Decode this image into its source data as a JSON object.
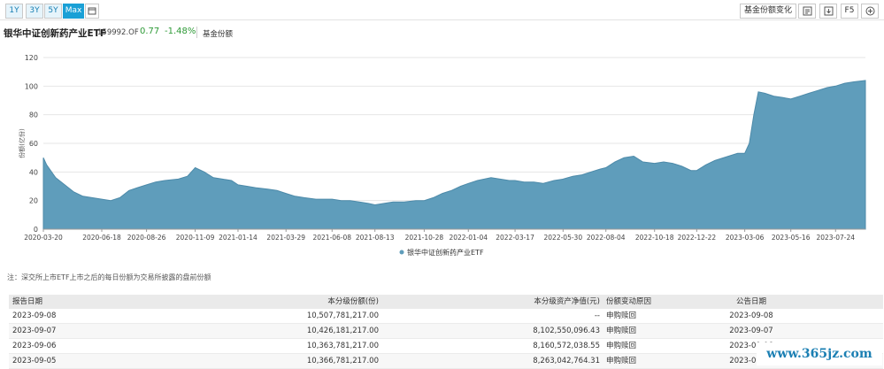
{
  "toolbar": {
    "ranges": [
      "1Y",
      "3Y",
      "5Y",
      "Max"
    ],
    "active_range": "Max",
    "calendar_icon": "calendar-icon",
    "change_label": "基金份额变化",
    "export_icon": "export-icon",
    "download_icon": "download-icon",
    "f5_label": "F5",
    "add_icon": "plus-circle-icon"
  },
  "fund": {
    "name": "银华中证创新药产业ETF",
    "code": "159992.OF",
    "price": "0.77",
    "change": "-1.48%",
    "metric": "基金份额"
  },
  "colors": {
    "area_fill": "#5f9dbb",
    "area_stroke": "#4d8aa9",
    "active": "#1aa0d6",
    "positive_change": "#2e9a37"
  },
  "chart_data": {
    "type": "area",
    "ylabel": "份额(亿份)",
    "ylim": [
      0,
      120
    ],
    "yticks": [
      "0",
      "20",
      "40",
      "60",
      "80",
      "100",
      "120"
    ],
    "xticks": [
      "2020-03-20",
      "2020-06-18",
      "2020-08-26",
      "2020-11-09",
      "2021-01-14",
      "2021-03-29",
      "2021-06-08",
      "2021-08-13",
      "2021-10-28",
      "2022-01-04",
      "2022-03-17",
      "2022-05-30",
      "2022-08-04",
      "2022-10-18",
      "2022-12-22",
      "2023-03-06",
      "2023-05-16",
      "2023-07-24"
    ],
    "x": [
      "2020-03-20",
      "2020-03-25",
      "2020-04-08",
      "2020-04-22",
      "2020-05-06",
      "2020-05-20",
      "2020-06-03",
      "2020-06-18",
      "2020-07-02",
      "2020-07-16",
      "2020-07-30",
      "2020-08-12",
      "2020-08-26",
      "2020-09-09",
      "2020-09-23",
      "2020-10-14",
      "2020-10-28",
      "2020-11-09",
      "2020-11-23",
      "2020-12-07",
      "2020-12-21",
      "2021-01-04",
      "2021-01-14",
      "2021-01-28",
      "2021-02-10",
      "2021-03-01",
      "2021-03-15",
      "2021-03-29",
      "2021-04-12",
      "2021-04-26",
      "2021-05-14",
      "2021-05-28",
      "2021-06-08",
      "2021-06-22",
      "2021-07-06",
      "2021-07-20",
      "2021-08-03",
      "2021-08-13",
      "2021-08-27",
      "2021-09-10",
      "2021-09-27",
      "2021-10-15",
      "2021-10-28",
      "2021-11-11",
      "2021-11-25",
      "2021-12-09",
      "2021-12-23",
      "2022-01-04",
      "2022-01-18",
      "2022-02-08",
      "2022-02-22",
      "2022-03-08",
      "2022-03-17",
      "2022-03-31",
      "2022-04-15",
      "2022-04-29",
      "2022-05-16",
      "2022-05-30",
      "2022-06-14",
      "2022-06-28",
      "2022-07-12",
      "2022-07-26",
      "2022-08-04",
      "2022-08-18",
      "2022-09-01",
      "2022-09-16",
      "2022-09-30",
      "2022-10-18",
      "2022-11-01",
      "2022-11-15",
      "2022-11-29",
      "2022-12-13",
      "2022-12-22",
      "2023-01-05",
      "2023-01-19",
      "2023-02-09",
      "2023-02-23",
      "2023-03-06",
      "2023-03-13",
      "2023-03-20",
      "2023-03-27",
      "2023-04-06",
      "2023-04-20",
      "2023-05-04",
      "2023-05-16",
      "2023-05-30",
      "2023-06-13",
      "2023-06-27",
      "2023-07-11",
      "2023-07-24",
      "2023-08-07",
      "2023-08-21",
      "2023-09-08"
    ],
    "series": [
      {
        "name": "银华中证创新药产业ETF",
        "values": [
          50,
          45,
          36,
          31,
          26,
          23,
          22,
          21,
          20,
          22,
          27,
          29,
          31,
          33,
          34,
          35,
          37,
          43,
          40,
          36,
          35,
          34,
          31,
          30,
          29,
          28,
          27,
          25,
          23,
          22,
          21,
          21,
          21,
          20,
          20,
          19,
          18,
          17,
          18,
          19,
          19,
          20,
          20,
          22,
          25,
          27,
          30,
          32,
          34,
          36,
          35,
          34,
          34,
          33,
          33,
          32,
          34,
          35,
          37,
          38,
          40,
          42,
          43,
          47,
          50,
          51,
          47,
          46,
          47,
          46,
          44,
          41,
          41,
          45,
          48,
          51,
          53,
          53,
          60,
          80,
          96,
          95,
          93,
          92,
          91,
          93,
          95,
          97,
          99,
          100,
          102,
          103,
          104
        ]
      }
    ],
    "legend": {
      "position": "bottom-center",
      "label": "银华中证创新药产业ETF"
    },
    "grid": true
  },
  "note": "注：深交所上市ETF上市之后的每日份额为交易所披露的盘前份额",
  "table": {
    "headers": [
      "报告日期",
      "本分级份额(份)",
      "本分级资产净值(元)",
      "份额变动原因",
      "公告日期"
    ],
    "rows": [
      [
        "2023-09-08",
        "10,507,781,217.00",
        "--",
        "申购赎回",
        "2023-09-08"
      ],
      [
        "2023-09-07",
        "10,426,181,217.00",
        "8,102,550,096.43",
        "申购赎回",
        "2023-09-07"
      ],
      [
        "2023-09-06",
        "10,363,781,217.00",
        "8,160,572,038.55",
        "申购赎回",
        "2023-09-06"
      ],
      [
        "2023-09-05",
        "10,366,781,217.00",
        "8,263,042,764.31",
        "申购赎回",
        "2023-09-05"
      ]
    ]
  },
  "watermark": "www.365jz.com"
}
